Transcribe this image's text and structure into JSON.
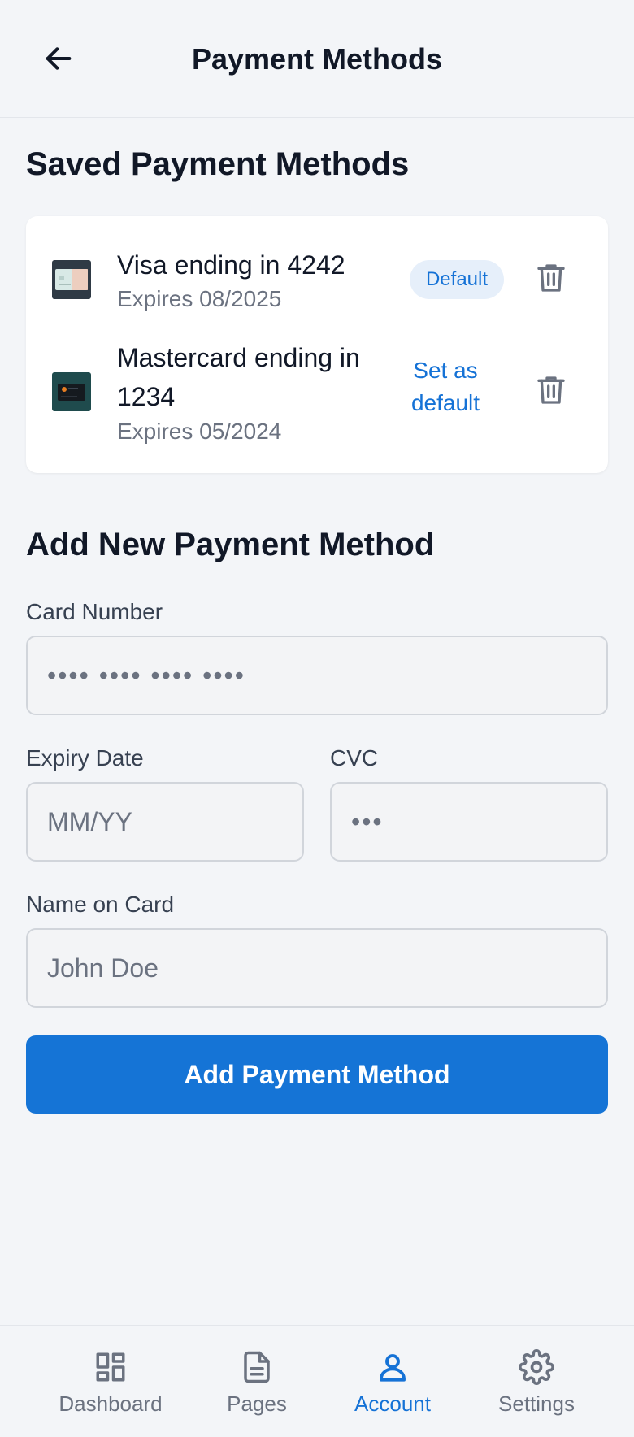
{
  "header": {
    "title": "Payment Methods"
  },
  "saved": {
    "title": "Saved Payment Methods",
    "methods": [
      {
        "name": "Visa ending in 4242",
        "expires": "Expires 08/2025",
        "badge": "Default"
      },
      {
        "name_line1": "Mastercard ending in",
        "name_line2": "1234",
        "expires": "Expires 05/2024",
        "action_line1": "Set as",
        "action_line2": "default"
      }
    ]
  },
  "form": {
    "title": "Add New Payment Method",
    "card_number": {
      "label": "Card Number",
      "placeholder": "•••• •••• •••• ••••"
    },
    "expiry": {
      "label": "Expiry Date",
      "placeholder": "MM/YY"
    },
    "cvc": {
      "label": "CVC",
      "placeholder": "•••"
    },
    "name": {
      "label": "Name on Card",
      "placeholder": "John Doe"
    },
    "submit": "Add Payment Method"
  },
  "nav": {
    "items": [
      {
        "label": "Dashboard",
        "icon": "dashboard-icon"
      },
      {
        "label": "Pages",
        "icon": "document-icon"
      },
      {
        "label": "Account",
        "icon": "user-icon",
        "active": true
      },
      {
        "label": "Settings",
        "icon": "gear-icon"
      }
    ]
  },
  "colors": {
    "accent": "#1574d6",
    "background": "#f3f5f8",
    "text": "#111827",
    "muted": "#6b7280"
  }
}
